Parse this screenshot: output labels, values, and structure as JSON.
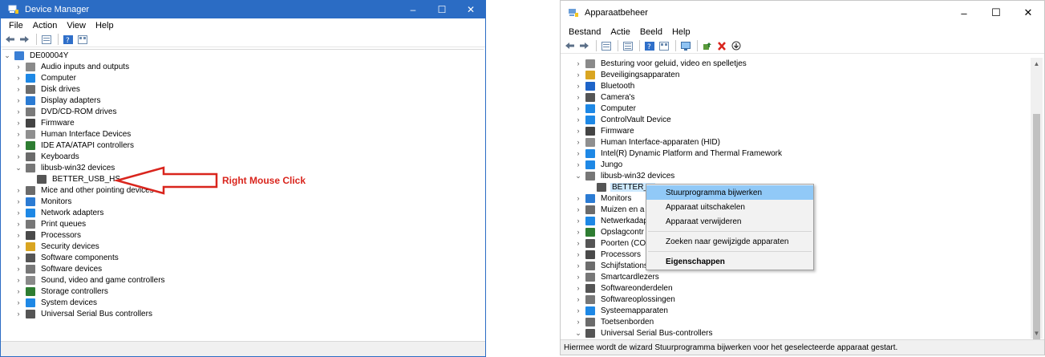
{
  "left": {
    "title": "Device Manager",
    "menu": [
      "File",
      "Action",
      "View",
      "Help"
    ],
    "root": "DE00004Y",
    "items": [
      {
        "label": "Audio inputs and outputs",
        "icon": "speaker-icon",
        "color": "#8a8a8a"
      },
      {
        "label": "Computer",
        "icon": "computer-icon",
        "color": "#1e88e5"
      },
      {
        "label": "Disk drives",
        "icon": "disk-drive-icon",
        "color": "#6d6d6d"
      },
      {
        "label": "Display adapters",
        "icon": "display-adapter-icon",
        "color": "#2b7bd3"
      },
      {
        "label": "DVD/CD-ROM drives",
        "icon": "dvd-drive-icon",
        "color": "#7a7a7a"
      },
      {
        "label": "Firmware",
        "icon": "firmware-icon",
        "color": "#444444"
      },
      {
        "label": "Human Interface Devices",
        "icon": "hid-icon",
        "color": "#8f8f8f"
      },
      {
        "label": "IDE ATA/ATAPI controllers",
        "icon": "ide-controller-icon",
        "color": "#2e7d32"
      },
      {
        "label": "Keyboards",
        "icon": "keyboard-icon",
        "color": "#6b6b6b"
      },
      {
        "label": "libusb-win32 devices",
        "icon": "usb-icon",
        "color": "#777777",
        "expanded": true
      },
      {
        "label": "BETTER_USB_HS",
        "icon": "usb-device-icon",
        "color": "#555555",
        "child": true
      },
      {
        "label": "Mice and other pointing devices",
        "icon": "mouse-icon",
        "color": "#6b6b6b"
      },
      {
        "label": "Monitors",
        "icon": "monitor-icon",
        "color": "#2b7bd3"
      },
      {
        "label": "Network adapters",
        "icon": "network-adapter-icon",
        "color": "#1e88e5"
      },
      {
        "label": "Print queues",
        "icon": "printer-icon",
        "color": "#777777"
      },
      {
        "label": "Processors",
        "icon": "processor-icon",
        "color": "#4a4a4a"
      },
      {
        "label": "Security devices",
        "icon": "security-icon",
        "color": "#d9a521"
      },
      {
        "label": "Software components",
        "icon": "software-component-icon",
        "color": "#555555"
      },
      {
        "label": "Software devices",
        "icon": "software-device-icon",
        "color": "#777777"
      },
      {
        "label": "Sound, video and game controllers",
        "icon": "sound-icon",
        "color": "#8a8a8a"
      },
      {
        "label": "Storage controllers",
        "icon": "storage-icon",
        "color": "#2e7d32"
      },
      {
        "label": "System devices",
        "icon": "system-device-icon",
        "color": "#1e88e5"
      },
      {
        "label": "Universal Serial Bus controllers",
        "icon": "usb-controller-icon",
        "color": "#555555"
      }
    ],
    "annotation": "Right Mouse Click"
  },
  "right": {
    "title": "Apparaatbeheer",
    "menu": [
      "Bestand",
      "Actie",
      "Beeld",
      "Help"
    ],
    "items": [
      {
        "label": "Besturing voor geluid, video en spelletjes",
        "icon": "sound-icon",
        "color": "#8a8a8a"
      },
      {
        "label": "Beveiligingsapparaten",
        "icon": "security-icon",
        "color": "#d9a521"
      },
      {
        "label": "Bluetooth",
        "icon": "bluetooth-icon",
        "color": "#1e64c8"
      },
      {
        "label": "Camera's",
        "icon": "camera-icon",
        "color": "#555555"
      },
      {
        "label": "Computer",
        "icon": "computer-icon",
        "color": "#1e88e5"
      },
      {
        "label": "ControlVault Device",
        "icon": "controlvault-icon",
        "color": "#1e88e5"
      },
      {
        "label": "Firmware",
        "icon": "firmware-icon",
        "color": "#444444"
      },
      {
        "label": "Human Interface-apparaten (HID)",
        "icon": "hid-icon",
        "color": "#8f8f8f"
      },
      {
        "label": "Intel(R) Dynamic Platform and Thermal Framework",
        "icon": "intel-framework-icon",
        "color": "#1e88e5"
      },
      {
        "label": "Jungo",
        "icon": "jungo-icon",
        "color": "#1e88e5"
      },
      {
        "label": "libusb-win32 devices",
        "icon": "usb-icon",
        "color": "#777777",
        "expanded": true
      },
      {
        "label": "BETTER_U",
        "icon": "usb-device-icon",
        "color": "#555555",
        "child": true,
        "selected": true
      },
      {
        "label": "Monitors",
        "icon": "monitor-icon",
        "color": "#2b7bd3"
      },
      {
        "label": "Muizen en a",
        "icon": "mouse-icon",
        "color": "#6b6b6b"
      },
      {
        "label": "Netwerkadap",
        "icon": "network-adapter-icon",
        "color": "#1e88e5"
      },
      {
        "label": "Opslagcontr",
        "icon": "storage-icon",
        "color": "#2e7d32"
      },
      {
        "label": "Poorten (CO",
        "icon": "port-icon",
        "color": "#555555"
      },
      {
        "label": "Processors",
        "icon": "processor-icon",
        "color": "#4a4a4a"
      },
      {
        "label": "Schijfstations",
        "icon": "disk-drive-icon",
        "color": "#6d6d6d"
      },
      {
        "label": "Smartcardlezers",
        "icon": "smartcard-icon",
        "color": "#777777"
      },
      {
        "label": "Softwareonderdelen",
        "icon": "software-component-icon",
        "color": "#555555"
      },
      {
        "label": "Softwareoplossingen",
        "icon": "software-device-icon",
        "color": "#777777"
      },
      {
        "label": "Systeemapparaten",
        "icon": "system-device-icon",
        "color": "#1e88e5"
      },
      {
        "label": "Toetsenborden",
        "icon": "keyboard-icon",
        "color": "#6b6b6b"
      },
      {
        "label": "Universal Serial Bus-controllers",
        "icon": "usb-controller-icon",
        "color": "#555555",
        "expanded": true
      }
    ],
    "context_menu": [
      {
        "label": "Stuurprogramma bijwerken",
        "highlight": true
      },
      {
        "label": "Apparaat uitschakelen"
      },
      {
        "label": "Apparaat verwijderen"
      },
      {
        "sep": true
      },
      {
        "label": "Zoeken naar gewijzigde apparaten"
      },
      {
        "sep": true
      },
      {
        "label": "Eigenschappen",
        "bold": true
      }
    ],
    "status": "Hiermee wordt de wizard Stuurprogramma bijwerken voor het geselecteerde apparaat gestart."
  }
}
